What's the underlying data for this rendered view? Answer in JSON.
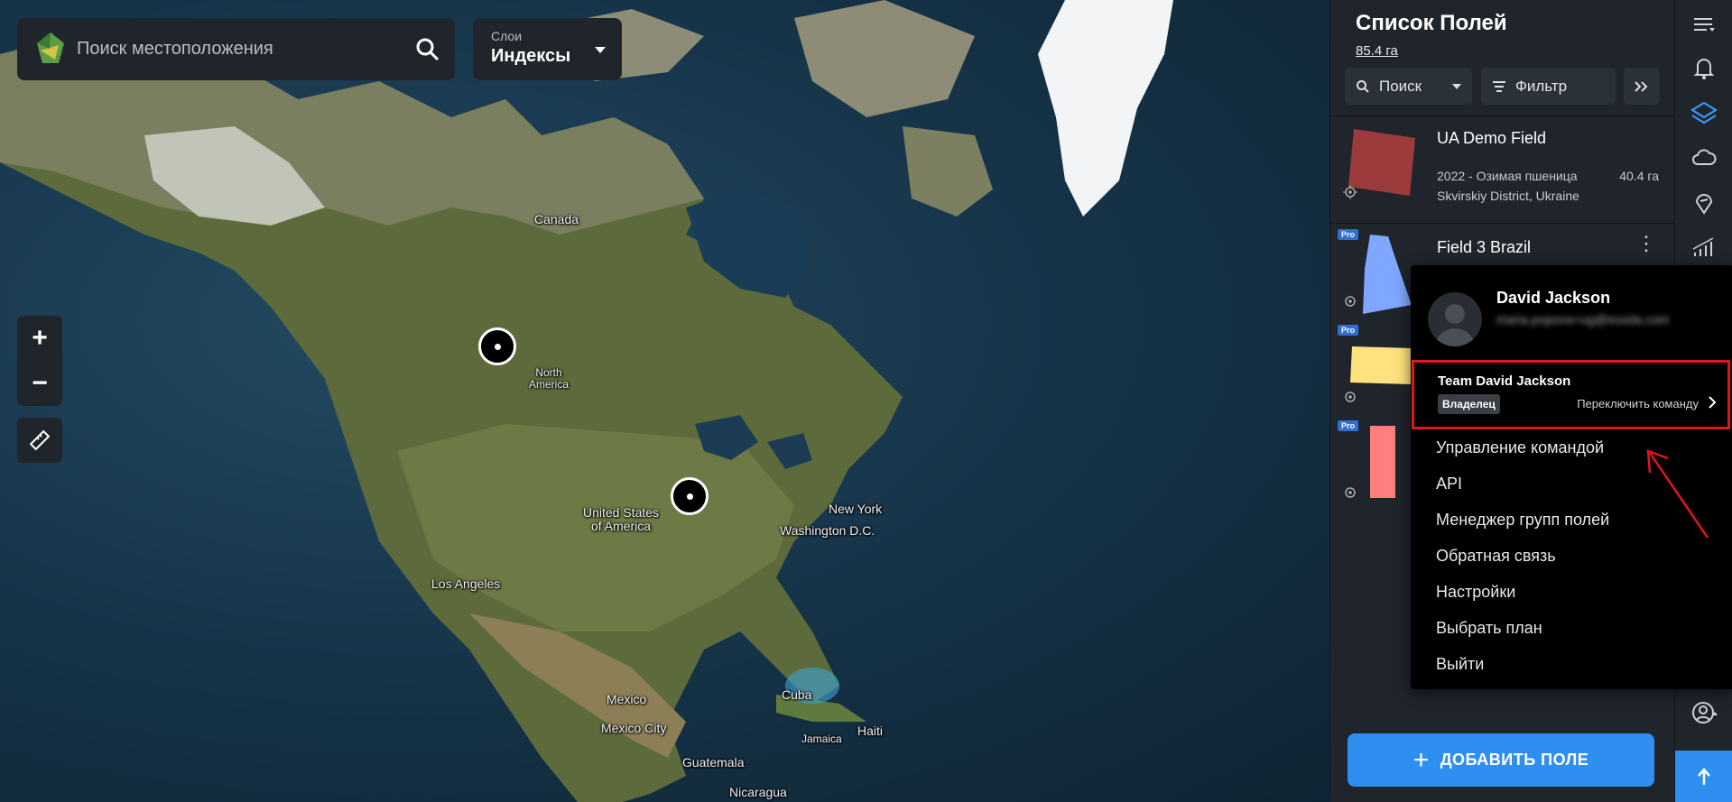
{
  "search": {
    "placeholder": "Поиск местоположения"
  },
  "layers": {
    "label": "Слои",
    "value": "Индексы"
  },
  "zoom": {
    "in": "+",
    "out": "−"
  },
  "map_labels": {
    "canada": "Canada",
    "north_america": "North\nAmerica",
    "united_states": "United States\nof America",
    "new_york": "New York",
    "washington": "Washington D.C.",
    "los_angeles": "Los Angeles",
    "mexico": "Mexico",
    "mexico_city": "Mexico City",
    "cuba": "Cuba",
    "haiti": "Haiti",
    "jamaica": "Jamaica",
    "guatemala": "Guatemala",
    "nicaragua": "Nicaragua"
  },
  "panel": {
    "title": "Список Полей",
    "total_area": "85.4 га",
    "search_label": "Поиск",
    "filter_label": "Фильтр",
    "fields": [
      {
        "name": "UA Demo Field",
        "season": "2022 - Озимая пшеница",
        "area": "40.4 га",
        "location": "Skvirskiy District, Ukraine",
        "pro": "",
        "color": "#9b3b3b"
      },
      {
        "name": "Field 3 Brazil",
        "pro": "Pro",
        "color": "#7fa7ff"
      },
      {
        "pro": "Pro",
        "color": "#ffe17d"
      },
      {
        "pro": "Pro",
        "color": "#ff7f7f"
      }
    ],
    "add_button": "ДОБАВИТЬ ПОЛЕ"
  },
  "menu": {
    "user_name": "David Jackson",
    "user_email": "maria.popova+ug@eosda.com",
    "team_name": "Team David Jackson",
    "role": "Владелец",
    "switch_team": "Переключить команду",
    "items": [
      "Управление командой",
      "API",
      "Менеджер групп полей",
      "Обратная связь",
      "Настройки",
      "Выбрать план",
      "Выйти"
    ]
  },
  "rail_icons": [
    "list-icon",
    "bell-icon",
    "layers-icon",
    "cloud-icon",
    "location-icon",
    "signal-icon",
    "user-settings-icon",
    "arrow-up-icon"
  ],
  "colors": {
    "accent": "#2e8ff0",
    "highlight": "#e0161b",
    "panel": "#20252c"
  }
}
